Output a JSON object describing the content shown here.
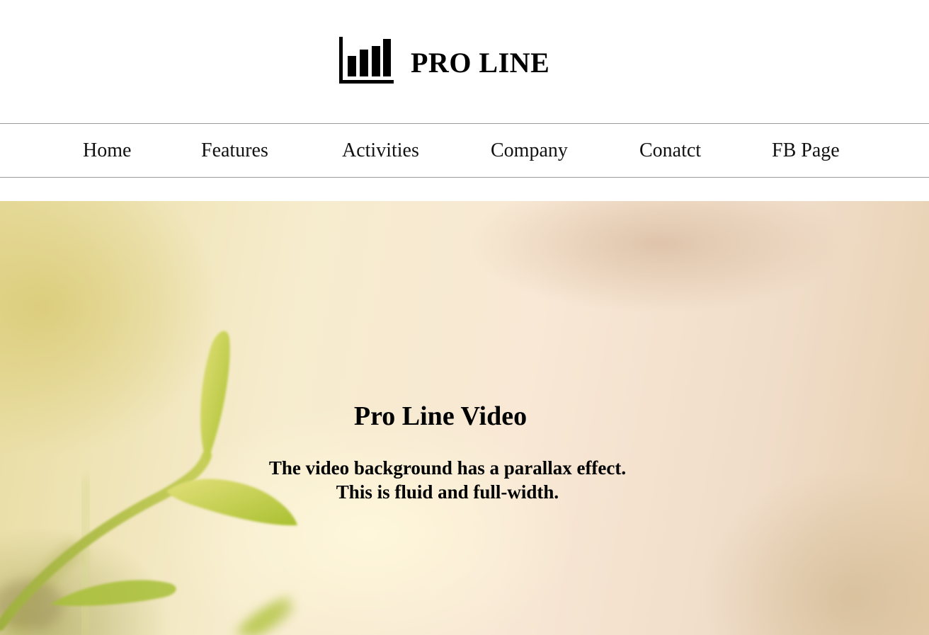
{
  "brand": {
    "name": "PRO LINE",
    "icon": "bar-chart-icon"
  },
  "nav": {
    "items": [
      {
        "label": "Home"
      },
      {
        "label": "Features"
      },
      {
        "label": "Activities"
      },
      {
        "label": "Company"
      },
      {
        "label": "Conatct"
      },
      {
        "label": "FB Page"
      }
    ]
  },
  "hero": {
    "title": "Pro Line Video",
    "subtitle_line1": "The video background has a parallax effect.",
    "subtitle_line2": "This is fluid and full-width."
  }
}
